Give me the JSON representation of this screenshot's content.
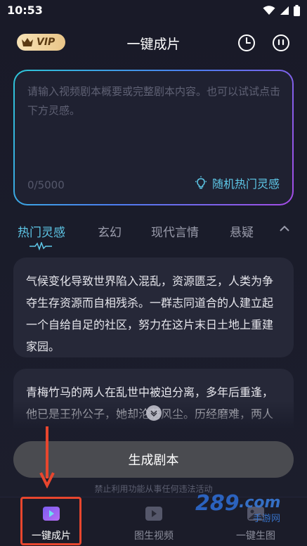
{
  "status_bar": {
    "time": "10:53"
  },
  "header": {
    "vip_label": "VIP",
    "title": "一键成片"
  },
  "input": {
    "placeholder": "请输入视频剧本概要或完整剧本内容。也可以试试点击下方灵感。",
    "counter": "0/5000",
    "inspire_label": "随机热门灵感"
  },
  "tabs": [
    {
      "label": "热门灵感",
      "active": true
    },
    {
      "label": "玄幻",
      "active": false
    },
    {
      "label": "现代言情",
      "active": false
    },
    {
      "label": "悬疑",
      "active": false
    }
  ],
  "cards": [
    {
      "text": "气候变化导致世界陷入混乱，资源匮乏，人类为争夺生存资源而自相残杀。一群志同道合的人建立起一个自给自足的社区，努力在这片末日土地上重建家园。"
    },
    {
      "text": "青梅竹马的两人在乱世中被迫分离，多年后重逢，他已是王孙公子，她却沦落风尘。历经磨难，两人终于破镜重圆，携手共度余生。"
    }
  ],
  "generate_button": "生成剧本",
  "notice": "禁止利用功能从事任何违法活动",
  "bottom_nav": [
    {
      "label": "一键成片",
      "active": true
    },
    {
      "label": "图生视频",
      "active": false
    },
    {
      "label": "一键生图",
      "active": false
    }
  ],
  "watermark": {
    "number": "289",
    "suffix": ".com",
    "sub": "手游网"
  },
  "colors": {
    "accent": "#5ec8e8",
    "highlight": "#e8462e",
    "card_bg": "#262838",
    "button_bg": "#4a4b50"
  }
}
